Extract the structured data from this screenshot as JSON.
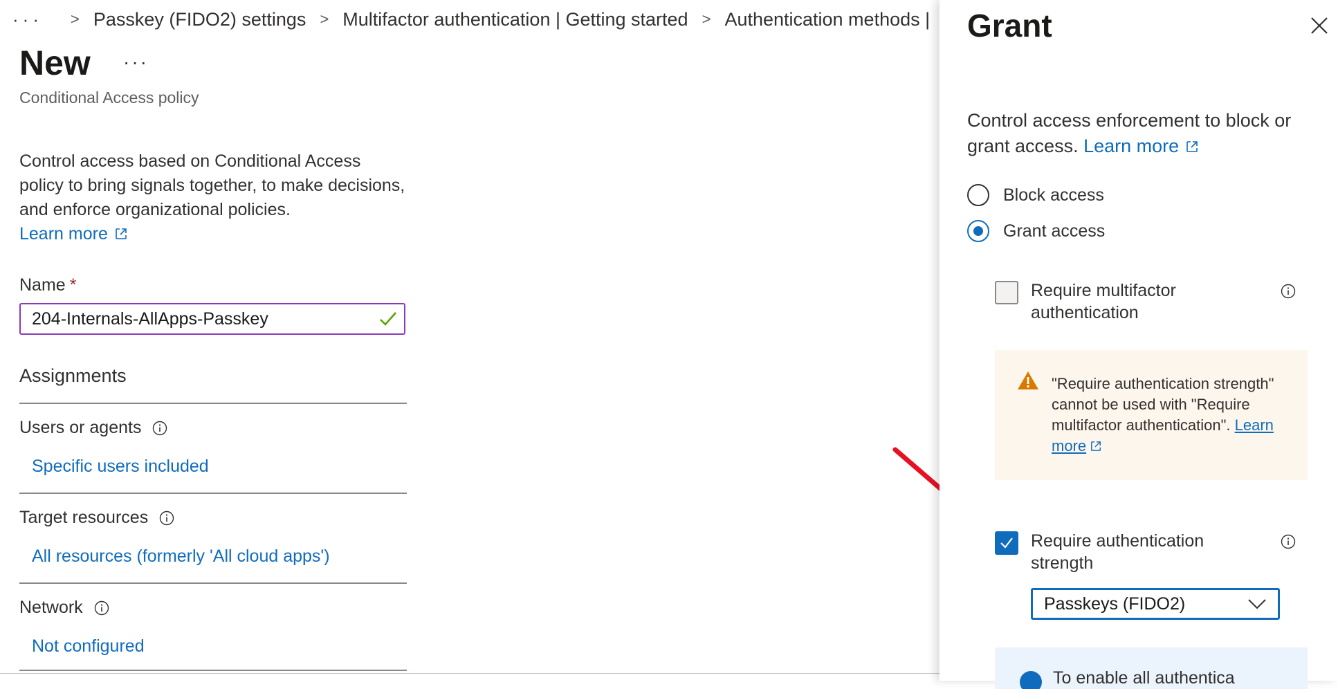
{
  "breadcrumb": {
    "more": "···",
    "items": [
      "Passkey (FIDO2) settings",
      "Multifactor authentication | Getting started",
      "Authentication methods |"
    ]
  },
  "page": {
    "title": "New",
    "title_more": "···",
    "subtitle": "Conditional Access policy",
    "intro": "Control access based on Conditional Access policy to bring signals together, to make decisions, and enforce organizational policies.",
    "learn_more": "Learn more"
  },
  "name_field": {
    "label": "Name",
    "required_mark": "*",
    "value": "204-Internals-AllApps-Passkey"
  },
  "assignments": {
    "heading": "Assignments",
    "sections": [
      {
        "label": "Users or agents",
        "value": "Specific users included"
      },
      {
        "label": "Target resources",
        "value": "All resources (formerly 'All cloud apps')"
      },
      {
        "label": "Network",
        "value": "Not configured"
      }
    ]
  },
  "grant_blade": {
    "title": "Grant",
    "description": "Control access enforcement to block or grant access.",
    "learn_more": "Learn more",
    "radios": [
      {
        "label": "Block access",
        "selected": false
      },
      {
        "label": "Grant access",
        "selected": true
      }
    ],
    "require_mfa": {
      "label": "Require multifactor authentication",
      "checked": false
    },
    "warning": {
      "text": "\"Require authentication strength\" cannot be used with \"Require multifactor authentication\".",
      "learn_more": "Learn more"
    },
    "require_strength": {
      "label": "Require authentication strength",
      "checked": true
    },
    "strength_dropdown": {
      "selected": "Passkeys (FIDO2)"
    },
    "info_partial": "To enable all authentica"
  },
  "colors": {
    "accent": "#0f6cbd",
    "input_border": "#8a3ab9",
    "valid_check": "#57a300",
    "warning_icon": "#d97a00",
    "warning_bg": "#fdf6ed",
    "info_bg": "#ebf3fc",
    "annotation_arrow": "#e81123"
  },
  "icons": {
    "external_link": "external-link-icon",
    "info": "info-icon",
    "close": "close-icon",
    "warning": "warning-icon",
    "checkmark": "checkmark-icon",
    "chevron": "chevron-down-icon"
  }
}
